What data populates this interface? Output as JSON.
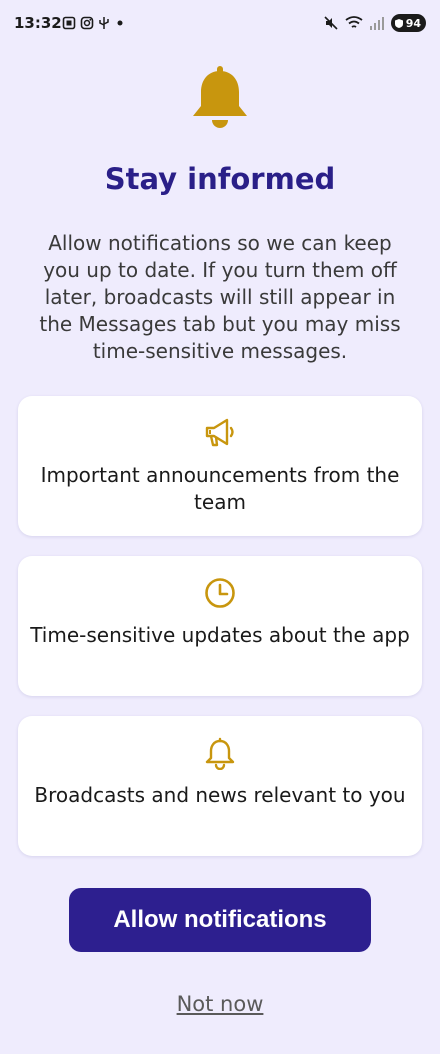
{
  "status_bar": {
    "time": "13:32",
    "battery": "94",
    "left_icons": [
      "screenshot-icon",
      "instagram-icon",
      "usb-icon",
      "dot-icon"
    ],
    "right_icons": [
      "mute-icon",
      "wifi-icon",
      "signal-icon",
      "battery-icon"
    ]
  },
  "hero": {
    "icon": "bell-icon",
    "title": "Stay informed",
    "description": "Allow notifications so we can keep you up to date. If you turn them off later, broadcasts will still appear in the Messages tab but you may miss time-sensitive messages."
  },
  "features": [
    {
      "icon": "megaphone-icon",
      "text": "Important announcements from the team"
    },
    {
      "icon": "clock-icon",
      "text": "Time-sensitive updates about the app"
    },
    {
      "icon": "bell-outline-icon",
      "text": "Broadcasts and news relevant to you"
    }
  ],
  "actions": {
    "primary_label": "Allow notifications",
    "secondary_label": "Not now"
  },
  "colors": {
    "background": "#efecfd",
    "title": "#2a1f88",
    "primary_button": "#2d1f8f",
    "icon_gold": "#c8960e"
  }
}
